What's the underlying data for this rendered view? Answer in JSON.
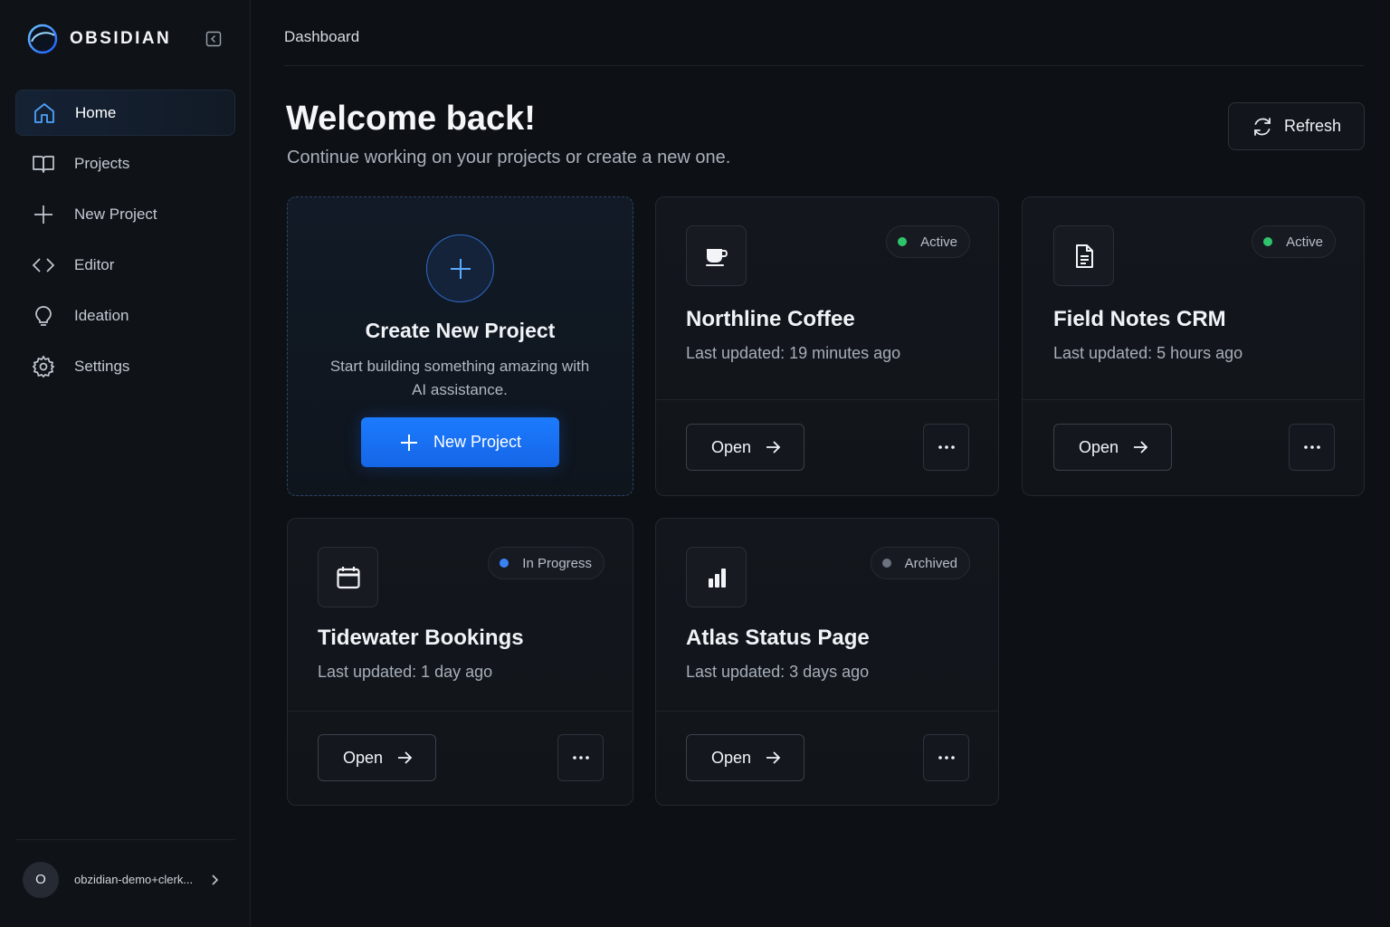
{
  "app": {
    "brand": "OBSIDIAN"
  },
  "sidebar": {
    "items": [
      {
        "label": "Home",
        "icon": "home-icon",
        "active": true
      },
      {
        "label": "Projects",
        "icon": "book-icon"
      },
      {
        "label": "New Project",
        "icon": "plus-icon"
      },
      {
        "label": "Editor",
        "icon": "code-icon"
      },
      {
        "label": "Ideation",
        "icon": "lightbulb-icon"
      },
      {
        "label": "Settings",
        "icon": "gear-icon"
      }
    ],
    "user": {
      "initial": "O",
      "name": "obzidian-demo+clerk..."
    }
  },
  "header": {
    "breadcrumb": "Dashboard",
    "title": "Welcome back!",
    "subtitle": "Continue working on your projects or create a new one.",
    "refresh_label": "Refresh"
  },
  "create_card": {
    "title": "Create New Project",
    "description": "Start building something amazing with AI assistance.",
    "button_label": "New Project"
  },
  "projects": [
    {
      "name": "Northline Coffee",
      "updated": "Last updated: 19 minutes ago",
      "status": "Active",
      "status_color": "#2fc46b",
      "icon": "coffee-cup-icon",
      "open_label": "Open"
    },
    {
      "name": "Field Notes CRM",
      "updated": "Last updated: 5 hours ago",
      "status": "Active",
      "status_color": "#2fc46b",
      "icon": "document-icon",
      "open_label": "Open"
    },
    {
      "name": "Tidewater Bookings",
      "updated": "Last updated: 1 day ago",
      "status": "In Progress",
      "status_color": "#3b82f6",
      "icon": "calendar-icon",
      "open_label": "Open"
    },
    {
      "name": "Atlas Status Page",
      "updated": "Last updated: 3 days ago",
      "status": "Archived",
      "status_color": "#6b7280",
      "icon": "bar-chart-icon",
      "open_label": "Open"
    }
  ],
  "colors": {
    "accent": "#1c7bff",
    "background": "#0d1015",
    "sidebar": "#0f1318"
  }
}
